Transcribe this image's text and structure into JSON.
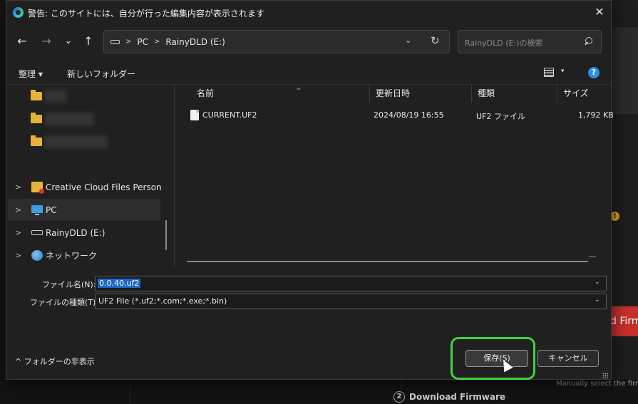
{
  "background": {
    "warning_badge": "!",
    "red_button_text": "d Firm",
    "manual_text": "Manually select the firmw",
    "step_number": "2",
    "step_label": "Download Firmware"
  },
  "dialog": {
    "title": "警告: このサイトには、自分が行った編集内容が表示されます",
    "close_glyph": "✕",
    "nav": {
      "back": "←",
      "forward": "→",
      "recent": "⌄",
      "up": "↑",
      "path": [
        "PC",
        "RainyDLD (E:)"
      ],
      "path_sep": ">",
      "dropdown": "⌄",
      "refresh": "↻",
      "search_placeholder": "RainyDLD (E:)の検索"
    },
    "toolbar": {
      "organize": "整理 ▾",
      "new_folder": "新しいフォルダー",
      "view_dropdown": "▾",
      "help": "?"
    },
    "nav_pane": {
      "items": [
        {
          "label": "Creative Cloud Files Personal A",
          "icon": "creative-cloud-icon"
        },
        {
          "label": "PC",
          "icon": "pc-icon",
          "selected": true
        },
        {
          "label": "RainyDLD (E:)",
          "icon": "drive-icon"
        },
        {
          "label": "ネットワーク",
          "icon": "network-icon"
        }
      ],
      "chevron": ">"
    },
    "columns": {
      "name": "名前",
      "date": "更新日時",
      "type": "種類",
      "size": "サイズ",
      "sort": "^"
    },
    "files": [
      {
        "name": "CURRENT.UF2",
        "date": "2024/08/19 16:55",
        "type": "UF2 ファイル",
        "size": "1,792 KB"
      }
    ],
    "form": {
      "filename_label": "ファイル名(N):",
      "filename_value": "0.0.40.uf2",
      "filetype_label": "ファイルの種類(T):",
      "filetype_value": "UF2 File (*.uf2;*.com;*.exe;*.bin)",
      "dropdown": "⌄"
    },
    "footer": {
      "hide_folders": "^  フォルダーの非表示",
      "save": "保存(S)",
      "cancel": "キャンセル"
    }
  }
}
